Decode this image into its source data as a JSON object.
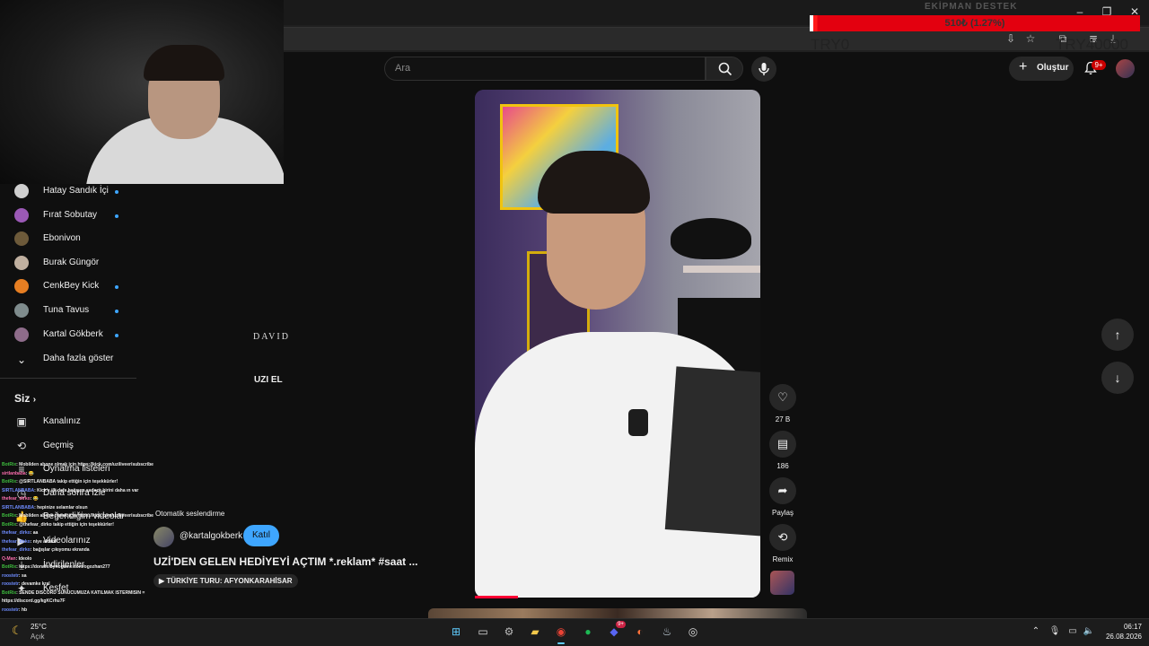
{
  "overlay": {
    "goal_title": "EKİPMAN DESTEK",
    "goal_progress_text": "510₺ (1.27%)",
    "goal_progress_fraction": 0.0127,
    "goal_min": "TRY0",
    "goal_max": "TRY40000"
  },
  "search": {
    "placeholder": "Ara"
  },
  "header": {
    "create_label": "Oluştur",
    "notifications_badge": "9+"
  },
  "sidebar": {
    "subscriptions": [
      {
        "name": "Hatay Sandık İçi",
        "avatar_color": "#cfcfcf",
        "new": true
      },
      {
        "name": "Fırat Sobutay",
        "avatar_color": "#9b59b6",
        "new": true
      },
      {
        "name": "Ebonivon",
        "avatar_color": "#6d5a3a",
        "new": false
      },
      {
        "name": "Burak Güngör",
        "avatar_color": "#c0b0a0",
        "new": false
      },
      {
        "name": "CenkBey Kick",
        "avatar_color": "#e67e22",
        "new": true
      },
      {
        "name": "Tuna Tavus",
        "avatar_color": "#7f8c8d",
        "new": true
      },
      {
        "name": "Kartal Gökberk",
        "avatar_color": "#8e6c8a",
        "new": true
      }
    ],
    "show_more": "Daha fazla göster",
    "you_heading": "Siz",
    "you_items": [
      {
        "label": "Kanalınız",
        "icon": "channel-icon"
      },
      {
        "label": "Geçmiş",
        "icon": "history-icon"
      },
      {
        "label": "Oynatma listeleri",
        "icon": "playlist-icon"
      },
      {
        "label": "Daha sonra izle",
        "icon": "watch-later-icon"
      },
      {
        "label": "Beğendiğim videolar",
        "icon": "like-icon"
      },
      {
        "label": "Videolarınız",
        "icon": "videos-icon"
      },
      {
        "label": "İndirilenler",
        "icon": "download-icon"
      },
      {
        "label": "Kesfet",
        "icon": "explore-icon"
      }
    ]
  },
  "chat": [
    {
      "user": "BotRix",
      "ucolor": "green",
      "text": ": Mobilden abone olmak için https://kick.com/uziliveer/subscribe"
    },
    {
      "user": "sirtlanbaba",
      "ucolor": "pink",
      "text": ": 😂"
    },
    {
      "user": "BotRix",
      "ucolor": "green",
      "text": ": @SIRTLANBABA takip ettiğin için teşekkürler!"
    },
    {
      "user": "SIRTLANBABA",
      "ucolor": "blue",
      "text": ": Kick'e ilk defa bağışım sadece birini daha ın var"
    },
    {
      "user": "thefear_dirko",
      "ucolor": "pink",
      "text": ": 😂"
    },
    {
      "user": "SIRTLANBABA",
      "ucolor": "blue",
      "text": ": hepinize selamlar olsun"
    },
    {
      "user": "BotRix",
      "ucolor": "green",
      "text": ": Mobilden abone olmak için https://kick.com/uziliveer/subscribe"
    },
    {
      "user": "BotRix",
      "ucolor": "green",
      "text": ": @thefear_dirko takip ettiğin için teşekkürler!"
    },
    {
      "user": "thefear_dirko",
      "ucolor": "blue",
      "text": ": aa"
    },
    {
      "user": "thefear_dirko",
      "ucolor": "blue",
      "text": ": niye aldatıl"
    },
    {
      "user": "thefear_dirko",
      "ucolor": "blue",
      "text": ": bağışlar çıkıyomu ekranda"
    },
    {
      "user": "Q-Man",
      "ucolor": "pink",
      "text": ": İdeolo"
    },
    {
      "user": "BotRix",
      "ucolor": "green",
      "text": ": https://donate.bynogame.com/ogozhan277"
    },
    {
      "user": "roostetr",
      "ucolor": "blue",
      "text": ": sa"
    },
    {
      "user": "roostetr",
      "ucolor": "blue",
      "text": ": devamke kral"
    },
    {
      "user": "BotRix",
      "ucolor": "green",
      "text": ": SENDE DISCORD SUNUCUMUZA KATILMAK İSTERMİSİN ="
    },
    {
      "user": "",
      "ucolor": "blue",
      "text": "https://discord.gg/kgKCrhu7F"
    },
    {
      "user": "roostetr",
      "ucolor": "blue",
      "text": ": hb"
    }
  ],
  "video": {
    "auto_dub": "Otomatik seslendirme",
    "channel_handle": "@kartalgokberk",
    "join_label": "Katıl",
    "title": "UZİ'DEN GELEN HEDİYEYİ AÇTIM *.reklam* #saat ...",
    "tour_chip": "TÜRKİYE TURU: AFYONKARAHİSAR",
    "box_brand": "DAVID",
    "box_text": "UZI EL",
    "progress_fraction": 0.15
  },
  "actions": {
    "like_count": "27 B",
    "comment_count": "186",
    "share_label": "Paylaş",
    "remix_label": "Remix"
  },
  "taskbar": {
    "weather_temp": "25°C",
    "weather_cond": "Açık",
    "time": "06:17",
    "date": "26.08.2026",
    "discord_badge": "9+"
  }
}
